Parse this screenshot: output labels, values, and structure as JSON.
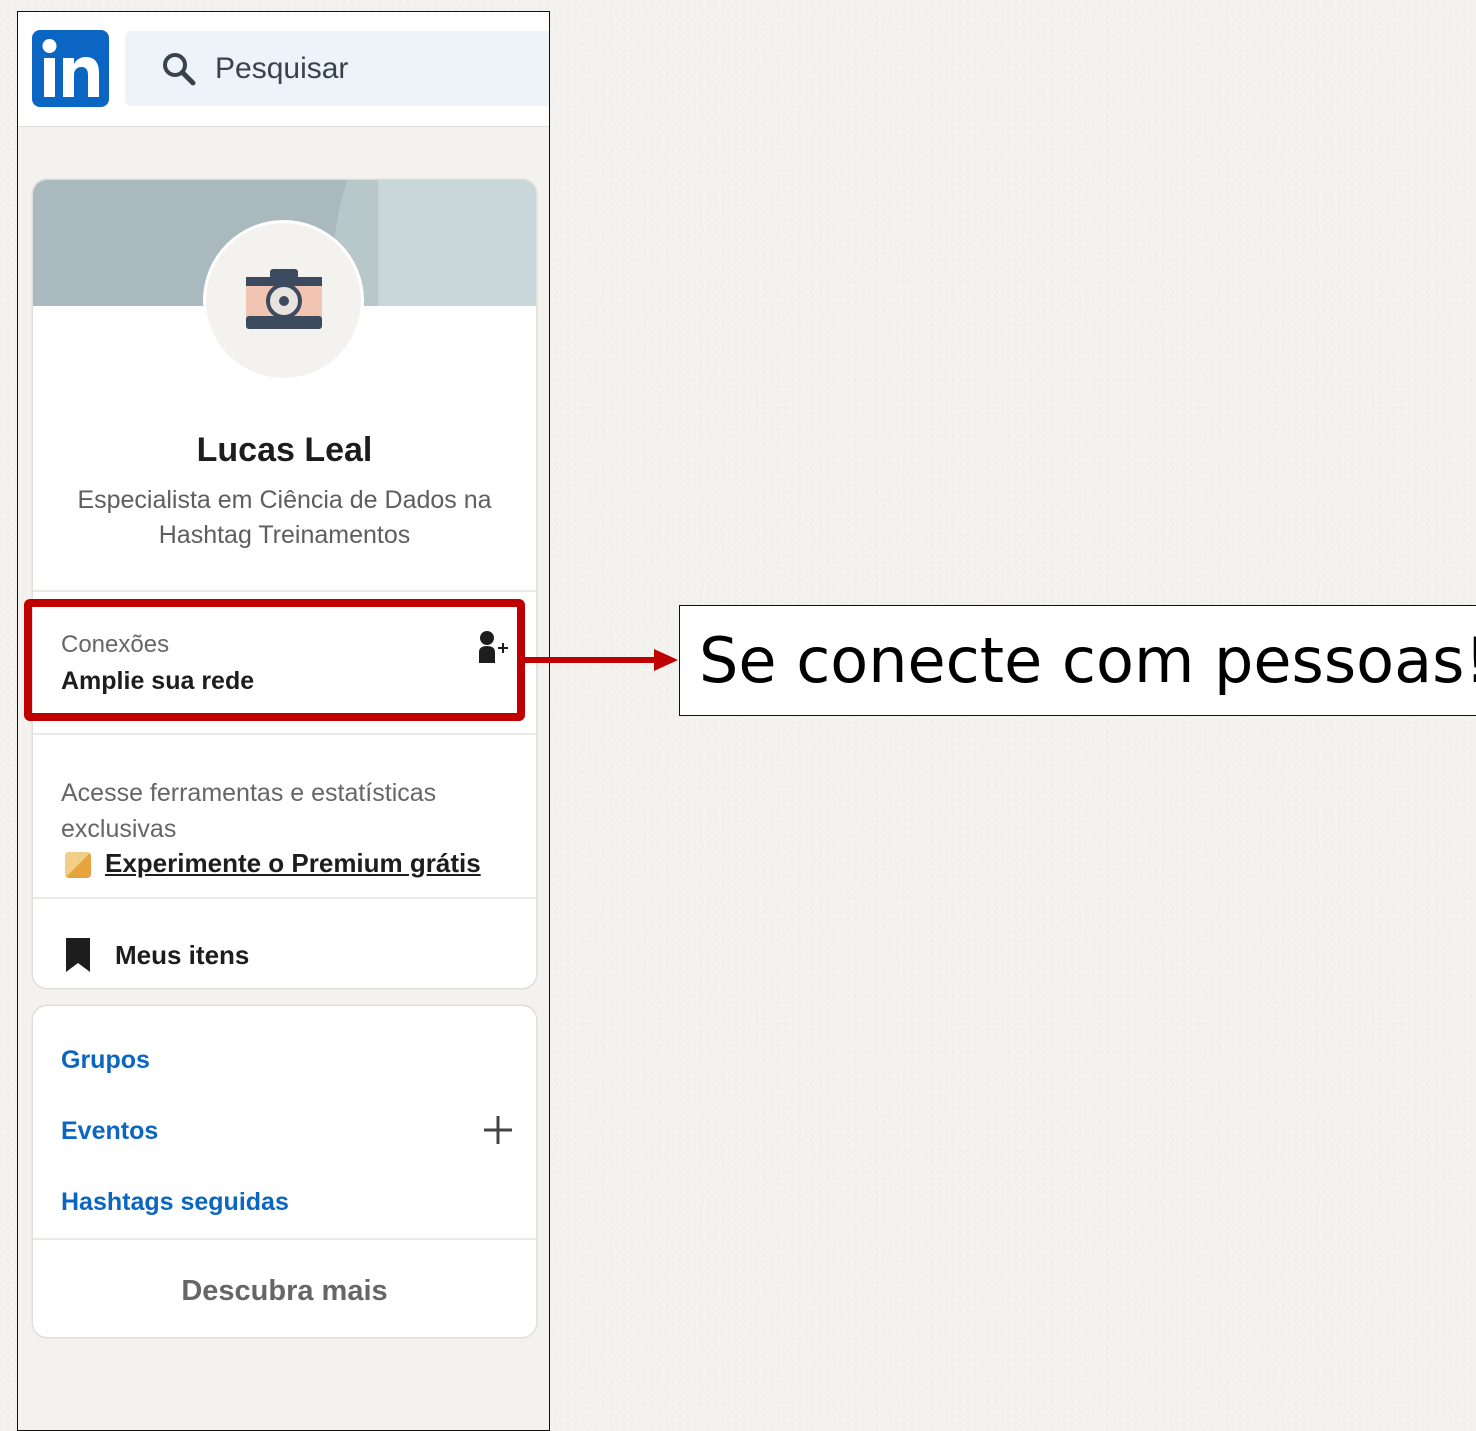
{
  "search": {
    "placeholder": "Pesquisar"
  },
  "profile": {
    "name": "Lucas Leal",
    "headline": "Especialista em Ciência de Dados na Hashtag Treinamentos"
  },
  "connections": {
    "label": "Conexões",
    "action": "Amplie sua rede"
  },
  "premium": {
    "text": "Acesse ferramentas e estatísticas exclusivas",
    "link": "Experimente o Premium grátis"
  },
  "saved": {
    "label": "Meus itens"
  },
  "community": {
    "items": [
      "Grupos",
      "Eventos",
      "Hashtags seguidas"
    ],
    "discover": "Descubra mais"
  },
  "annotation": {
    "text": "Se conecte com pessoas!",
    "color": "#c00000"
  },
  "colors": {
    "brand": "#0a66c2",
    "link": "#0a66c2",
    "premium": "#e7a33e"
  },
  "icons": [
    "linkedin-logo",
    "search-icon",
    "camera-icon",
    "add-person-icon",
    "premium-icon",
    "bookmark-icon",
    "plus-icon"
  ]
}
